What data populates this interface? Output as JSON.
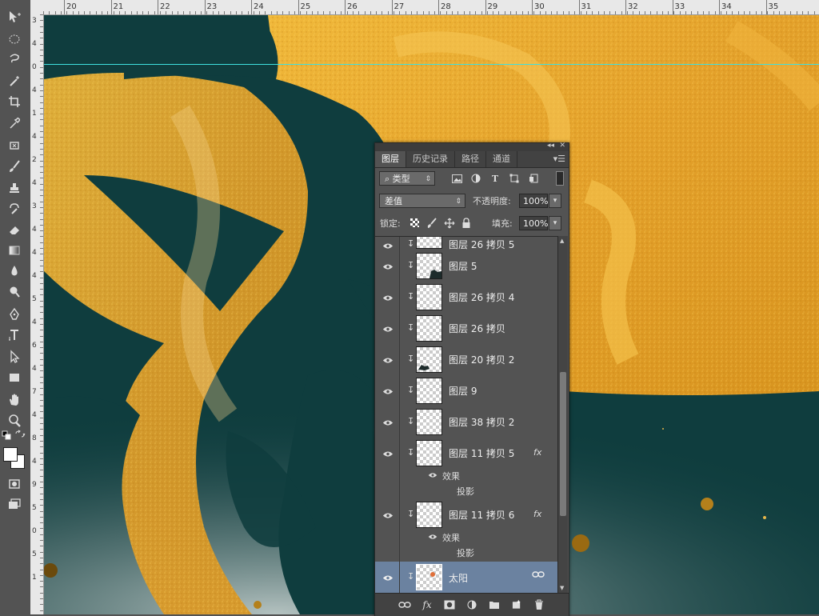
{
  "ruler": {
    "horizontal_ticks": [
      "20",
      "21",
      "22",
      "23",
      "24",
      "25",
      "26",
      "27",
      "28",
      "29",
      "30",
      "31",
      "32",
      "33",
      "34",
      "35"
    ],
    "vertical_ticks": [
      "3",
      "4",
      "0",
      "4",
      "1",
      "4",
      "2",
      "4",
      "3",
      "4",
      "4",
      "4",
      "5",
      "4",
      "6",
      "4",
      "7",
      "4",
      "8",
      "4",
      "9",
      "5",
      "0",
      "5",
      "1"
    ]
  },
  "layers_panel": {
    "tabs": [
      "图层",
      "历史记录",
      "路径",
      "通道"
    ],
    "active_tab": "图层",
    "filter": {
      "label": "类型",
      "icons": [
        "image-filter-icon",
        "adjustment-filter-icon",
        "text-filter-icon",
        "shape-filter-icon",
        "smart-object-filter-icon"
      ]
    },
    "blend_mode": "差值",
    "opacity_label": "不透明度:",
    "opacity_value": "100%",
    "lock_label": "锁定:",
    "fill_label": "填充:",
    "fill_value": "100%",
    "layers": [
      {
        "name": "图层 26 拷贝 5",
        "visible": true,
        "clipped": true,
        "fx": false,
        "selected": false
      },
      {
        "name": "图层 5",
        "visible": true,
        "clipped": true,
        "fx": false,
        "selected": false
      },
      {
        "name": "图层 26 拷贝 4",
        "visible": true,
        "clipped": true,
        "fx": false,
        "selected": false
      },
      {
        "name": "图层 26 拷贝",
        "visible": true,
        "clipped": true,
        "fx": false,
        "selected": false
      },
      {
        "name": "图层 20 拷贝 2",
        "visible": true,
        "clipped": true,
        "fx": false,
        "selected": false
      },
      {
        "name": "图层 9",
        "visible": true,
        "clipped": true,
        "fx": false,
        "selected": false
      },
      {
        "name": "图层 38 拷贝 2",
        "visible": true,
        "clipped": true,
        "fx": false,
        "selected": false
      },
      {
        "name": "图层 11 拷贝 5",
        "visible": true,
        "clipped": true,
        "fx": true,
        "fx_label": "fx",
        "effects_label": "效果",
        "effect_items": [
          "投影"
        ],
        "selected": false
      },
      {
        "name": "图层 11 拷贝 6",
        "visible": true,
        "clipped": true,
        "fx": true,
        "fx_label": "fx",
        "effects_label": "效果",
        "effect_items": [
          "投影"
        ],
        "selected": false
      },
      {
        "name": "太阳",
        "visible": true,
        "clipped": true,
        "fx": false,
        "linked": true,
        "selected": true
      }
    ],
    "bottom_buttons": [
      "link-layers-icon",
      "fx-icon",
      "mask-icon",
      "adjustment-icon",
      "folder-icon",
      "new-layer-icon",
      "trash-icon"
    ]
  },
  "colors": {
    "canvas_background": "#0f3d3e",
    "gold": "#e7a826",
    "guide": "#3ee0e0",
    "panel_bg": "#535353",
    "selected_row": "#6b82a0"
  }
}
